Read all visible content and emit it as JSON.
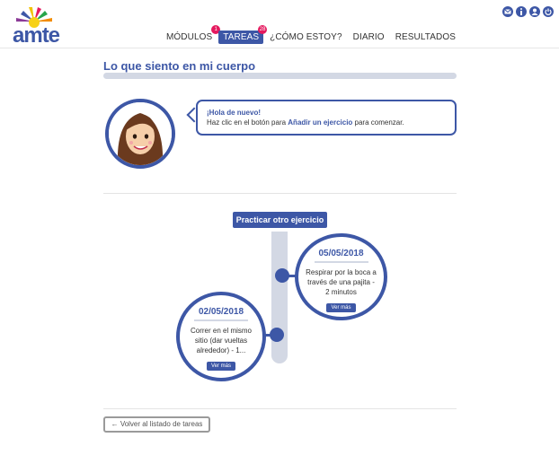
{
  "logo": {
    "text": "amte"
  },
  "nav": {
    "items": [
      {
        "label": "MÓDULOS",
        "badge": "1"
      },
      {
        "label": "TAREAS",
        "badge": "28"
      },
      {
        "label": "¿CÓMO ESTOY?"
      },
      {
        "label": "DIARIO"
      },
      {
        "label": "RESULTADOS"
      }
    ],
    "active_index": 1
  },
  "top_icons": [
    "mail-icon",
    "info-icon",
    "user-icon",
    "power-icon"
  ],
  "page": {
    "title": "Lo que siento en mi cuerpo"
  },
  "bubble": {
    "greeting": "¡Hola de nuevo!",
    "text_pre": "Haz clic en el botón para ",
    "text_strong": "Añadir un ejercicio",
    "text_post": " para comenzar."
  },
  "practice_button": "Practicar otro ejercicio",
  "entries": [
    {
      "date": "05/05/2018",
      "desc": "Respirar por la boca a través de una pajita - 2 minutos",
      "button": "Ver más"
    },
    {
      "date": "02/05/2018",
      "desc": "Correr en el mismo sitio (dar vueltas alrededor) - 1...",
      "button": "Ver más"
    }
  ],
  "back_button": "Volver al listado de tareas",
  "colors": {
    "primary": "#3d57a6",
    "badge": "#e5195e",
    "light": "#d3d8e4"
  }
}
